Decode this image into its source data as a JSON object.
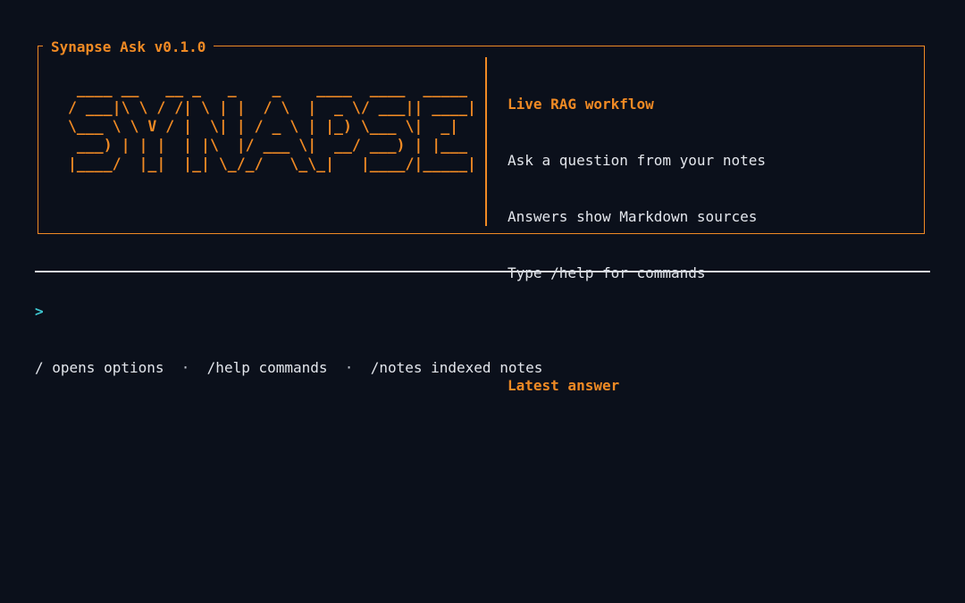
{
  "header": {
    "title": "Synapse Ask v0.1.0"
  },
  "banner": {
    "ascii_lines": [
      " ____ __   __ _   _    _    ____  ____  _____",
      "/ ___|\\ \\ / /| \\ | |  / \\  |  _ \\/ ___|| ____|",
      "\\___ \\ \\ V / |  \\| | / _ \\ | |_) \\___ \\|  _|",
      " ___) | | |  | |\\  |/ ___ \\|  __/ ___) | |___",
      "|____/  |_|  |_| \\_/_/   \\_\\_|   |____/|_____|"
    ]
  },
  "info": {
    "workflow_heading": "Live RAG workflow",
    "lines": [
      "Ask a question from your notes",
      "Answers show Markdown sources",
      "Type /help for commands"
    ],
    "answer_heading": "Latest answer"
  },
  "input": {
    "prompt_symbol": ">",
    "value": ""
  },
  "footer": {
    "hints": [
      "/ opens options",
      "/help commands",
      "/notes indexed notes"
    ],
    "separator": "·"
  }
}
